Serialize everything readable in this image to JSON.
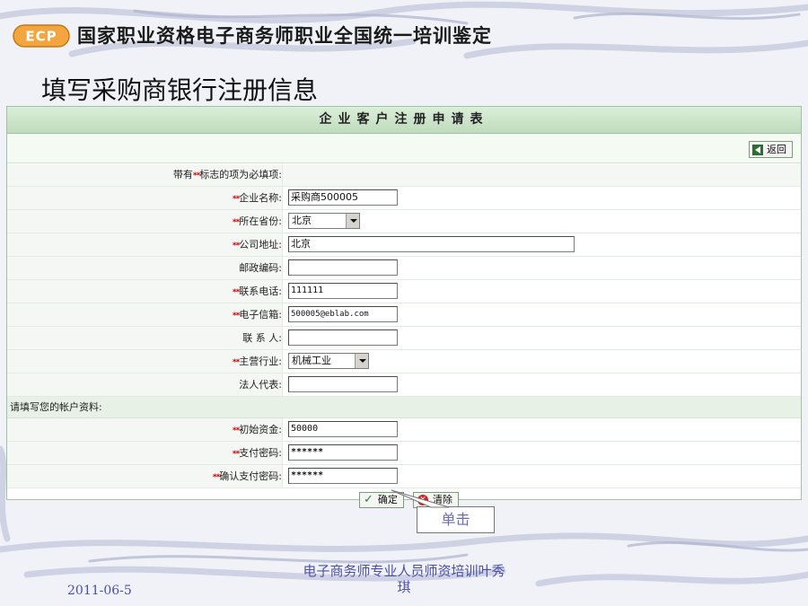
{
  "banner": {
    "logo_text": "ECP",
    "title": "国家职业资格电子商务师职业全国统一培训鉴定"
  },
  "slide": {
    "title": "填写采购商银行注册信息"
  },
  "form": {
    "header": "企业客户注册申请表",
    "back_label": "返回",
    "required_marker": "**",
    "required_note_pre": "带有",
    "required_note_post": "标志的项为必填项:",
    "fields": {
      "company_name": {
        "label": "企业名称:",
        "value": "采购商500005"
      },
      "province": {
        "label": "所在省份:",
        "value": "北京"
      },
      "address": {
        "label": "公司地址:",
        "value": "北京"
      },
      "postcode": {
        "label": "邮政编码:",
        "value": ""
      },
      "phone": {
        "label": "联系电话:",
        "value": "111111"
      },
      "email": {
        "label": "电子信箱:",
        "value": "500005@eblab.com"
      },
      "contact": {
        "label": "联 系 人:",
        "value": ""
      },
      "industry": {
        "label": "主营行业:",
        "value": "机械工业"
      },
      "legal_rep": {
        "label": "法人代表:",
        "value": ""
      }
    },
    "account_section": "请填写您的帐户资料:",
    "account": {
      "initial_funds": {
        "label": "初始资金:",
        "value": "50000"
      },
      "pay_password": {
        "label": "支付密码:",
        "value": "******"
      },
      "confirm_password": {
        "label": "确认支付密码:",
        "value": "******"
      }
    },
    "confirm_label": "确定",
    "clear_label": "清除"
  },
  "callout": {
    "text": "单击"
  },
  "footer": {
    "date": "2011-06-5",
    "author_line1": "电子商务师专业人员师资培训叶秀",
    "author_line2": "琪"
  }
}
